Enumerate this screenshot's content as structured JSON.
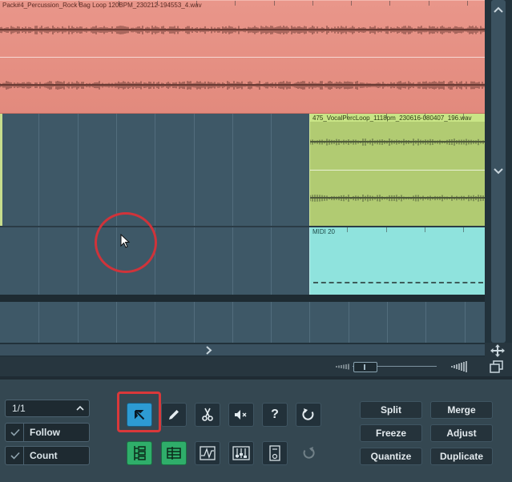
{
  "tracks": {
    "percussion_clip": {
      "name": "Pack#4_Percussion_Rock Bag Loop 120BPM_230212-194553_4.wav",
      "color": "#e5907f"
    },
    "vocal_clip": {
      "name": "475_VocalPercLoop_1118pm_230616-080407_196.wav",
      "color": "#b1cb72"
    },
    "midi_clip": {
      "name": "MIDI 20",
      "color": "#8fe3dd"
    }
  },
  "toolbar": {
    "position_value": "1/1",
    "follow_label": "Follow",
    "count_label": "Count",
    "tools": [
      {
        "name": "select-tool",
        "icon": "arrow-pointer-icon",
        "active": true
      },
      {
        "name": "pencil-tool",
        "icon": "pencil-icon"
      },
      {
        "name": "scissors-tool",
        "icon": "scissors-icon"
      },
      {
        "name": "mute-tool",
        "icon": "speaker-mute-icon"
      },
      {
        "name": "help-tool",
        "icon": "question-icon"
      },
      {
        "name": "undo-tool",
        "icon": "undo-icon"
      }
    ],
    "help_glyph": "?",
    "actions": {
      "split": "Split",
      "merge": "Merge",
      "freeze": "Freeze",
      "adjust": "Adjust",
      "quantize": "Quantize",
      "duplicate": "Duplicate"
    }
  },
  "colors": {
    "accent_active": "#2d9bd3",
    "toggle_green": "#2fae6a",
    "annotation_red": "#d9383a"
  }
}
